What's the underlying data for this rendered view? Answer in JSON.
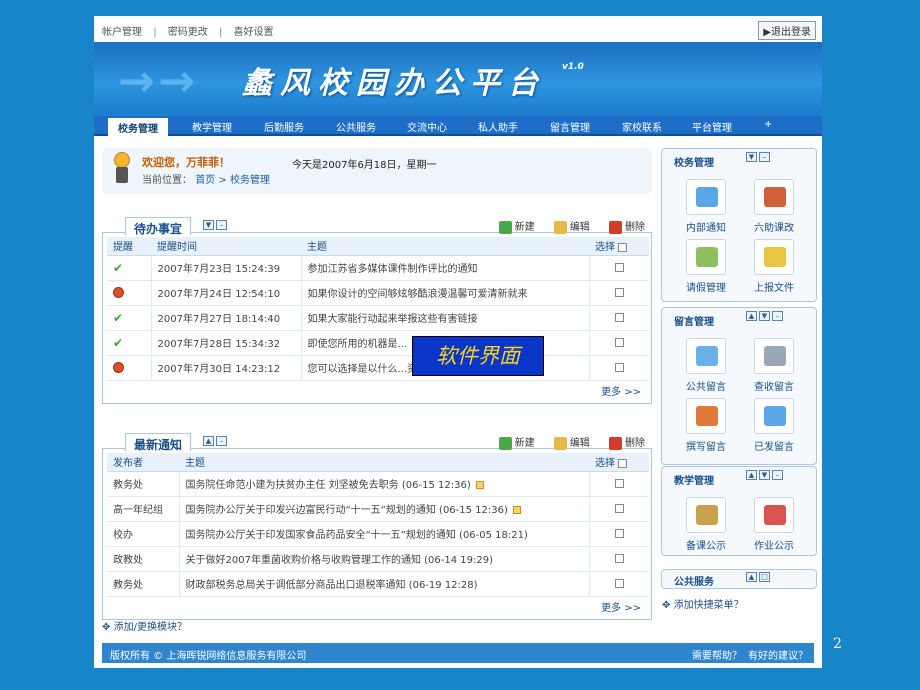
{
  "topbar": {
    "links": [
      "帐户管理",
      "密码更改",
      "喜好设置"
    ],
    "separator": "|",
    "logout": "退出登录"
  },
  "banner": {
    "title": "蠡风校园办公平台",
    "version": "v1.0"
  },
  "nav": {
    "tabs": [
      "校务管理",
      "教学管理",
      "后勤服务",
      "公共服务",
      "交流中心",
      "私人助手",
      "留言管理",
      "家校联系",
      "平台管理",
      "+"
    ]
  },
  "welcome": {
    "greeting": "欢迎您，万菲菲！",
    "today": "今天是2007年6月18日，星期一",
    "crumb_prefix": "当前位置：",
    "crumb_home": "首页",
    "crumb_sep": ">",
    "crumb_current": "校务管理"
  },
  "actions": {
    "new": "新建",
    "edit": "编辑",
    "delete": "删除",
    "more": "更多 >>"
  },
  "todo": {
    "title": "待办事宜",
    "headers": [
      "提醒",
      "提醒时间",
      "主题",
      "选择"
    ],
    "rows": [
      {
        "status": "ok",
        "time": "2007年7月23日 15:24:39",
        "subject": "参加江苏省多媒体课件制作评比的通知"
      },
      {
        "status": "no",
        "time": "2007年7月24日 12:54:10",
        "subject": "如果你设计的空间够炫够酷浪漫温馨可爱清新就来"
      },
      {
        "status": "ok",
        "time": "2007年7月27日 18:14:40",
        "subject": "如果大家能行动起来举报这些有害链接"
      },
      {
        "status": "ok",
        "time": "2007年7月28日 15:34:32",
        "subject": "即使您所用的机器是..."
      },
      {
        "status": "no",
        "time": "2007年7月30日 14:23:12",
        "subject": "您可以选择是以什么...资料"
      }
    ]
  },
  "notices": {
    "title": "最新通知",
    "headers": [
      "发布者",
      "主题",
      "选择"
    ],
    "rows": [
      {
        "publisher": "教务处",
        "subject": "国务院任命范小建为扶贫办主任 刘坚被免去职务 (06-15 12:36)",
        "tag": true
      },
      {
        "publisher": "高一年纪组",
        "subject": "国务院办公厅关于印发兴边富民行动“十一五”规划的通知 (06-15 12:36)",
        "tag": true
      },
      {
        "publisher": "校办",
        "subject": "国务院办公厅关于印发国家食品药品安全“十一五”规划的通知 (06-05 18:21)",
        "tag": false
      },
      {
        "publisher": "政教处",
        "subject": "关于做好2007年重菌收购价格与收购管理工作的通知 (06-14 19:29)",
        "tag": false
      },
      {
        "publisher": "教务处",
        "subject": "财政部税务总局关于调低部分商品出口退税率通知 (06-19 12:28)",
        "tag": false
      }
    ]
  },
  "overlay": "软件界面",
  "add_module": "添加/更换模块？",
  "footer": {
    "copyright": "版权所有 © 上海晖锐网络信息服务有限公司",
    "help": "需要帮助？",
    "suggest": "有好的建议？"
  },
  "sidebar": {
    "school": {
      "title": "校务管理",
      "tiles": [
        "内部通知",
        "六助课改",
        "请假管理",
        "上报文件"
      ]
    },
    "messages": {
      "title": "留言管理",
      "tiles": [
        "公共留言",
        "查收留言",
        "撰写留言",
        "已发留言"
      ]
    },
    "teaching": {
      "title": "教学管理",
      "tiles": [
        "备课公示",
        "作业公示"
      ]
    },
    "public": {
      "title": "公共服务"
    },
    "add_quick": "添加快捷菜单？"
  },
  "page_number": "2"
}
